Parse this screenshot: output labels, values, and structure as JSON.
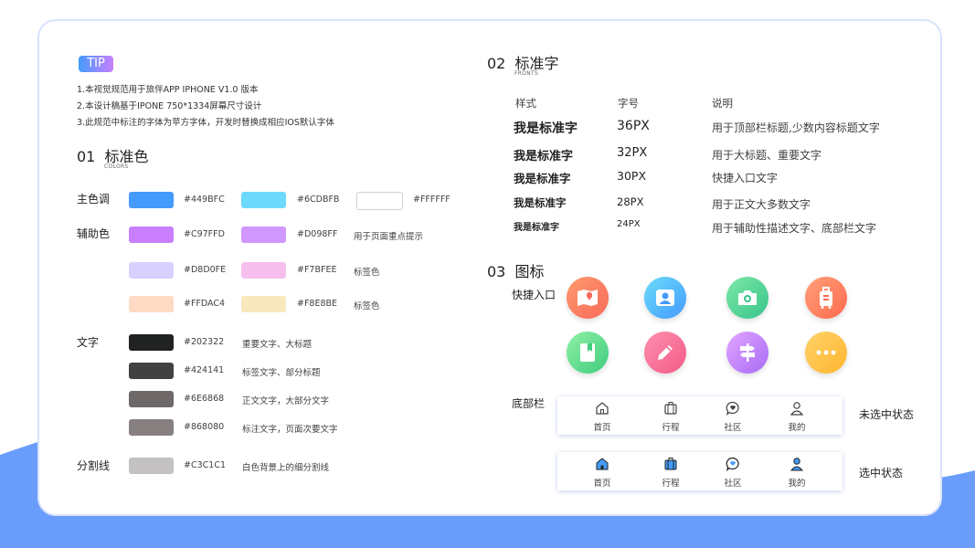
{
  "tip": {
    "badge": "TIP",
    "lines": [
      "1.本视觉规范用于旅伴APP IPHONE V1.0 版本",
      "2.本设计稿基于IPONE 750*1334屏幕尺寸设计",
      "3.此规范中标注的字体为苹方字体，开发时替换成相应IOS默认字体"
    ]
  },
  "colors_section": {
    "number": "01",
    "title": "标准色",
    "subtitle": "COLORS",
    "rows": [
      {
        "label": "主色调",
        "swatches": [
          {
            "color": "#449BFC",
            "hex": "#449BFC"
          },
          {
            "color": "#6CDBFB",
            "hex": "#6CDBFB"
          },
          {
            "color": "#FFFFFF",
            "hex": "#FFFFFF"
          }
        ],
        "note": ""
      },
      {
        "label": "辅助色",
        "swatches": [
          {
            "color": "#C97FFD",
            "hex": "#C97FFD"
          },
          {
            "color": "#D098FF",
            "hex": "#D098FF"
          }
        ],
        "note": "用于页面重点提示"
      },
      {
        "label": "",
        "swatches": [
          {
            "color": "#D8D0FE",
            "hex": "#D8D0FE"
          },
          {
            "color": "#F7BFEE",
            "hex": "#F7BFEE"
          }
        ],
        "note": "标签色"
      },
      {
        "label": "",
        "swatches": [
          {
            "color": "#FFDAC4",
            "hex": "#FFDAC4"
          },
          {
            "color": "#F8E8BE",
            "hex": "#F8E8BE"
          }
        ],
        "note": "标签色"
      }
    ],
    "text_label": "文字",
    "text_colors": [
      {
        "color": "#202322",
        "hex": "#202322",
        "note": "重要文字、大标题"
      },
      {
        "color": "#424141",
        "hex": "#424141",
        "note": "标签文字、部分标题"
      },
      {
        "color": "#6E6868",
        "hex": "#6E6868",
        "note": "正文文字，大部分文字"
      },
      {
        "color": "#868080",
        "hex": "#868080",
        "note": "标注文字，页面次要文字"
      }
    ],
    "divider_label": "分割线",
    "divider": {
      "color": "#C3C1C1",
      "hex": "#C3C1C1",
      "note": "白色背景上的细分割线"
    }
  },
  "fonts_section": {
    "number": "02",
    "title": "标准字",
    "subtitle": "FRONTS",
    "headers": {
      "style": "样式",
      "size": "字号",
      "desc": "说明"
    },
    "rows": [
      {
        "sample": "我是标准字",
        "size": "36PX",
        "desc": "用于顶部栏标题,少数内容标题文字"
      },
      {
        "sample": "我是标准字",
        "size": "32PX",
        "desc": "用于大标题、重要文字"
      },
      {
        "sample": "我是标准字",
        "size": "30PX",
        "desc": "快捷入口文字"
      },
      {
        "sample": "我是标准字",
        "size": "28PX",
        "desc": "用于正文大多数文字"
      },
      {
        "sample": "我是标准字",
        "size": "24PX",
        "desc": "用于辅助性描述文字、底部栏文字"
      }
    ]
  },
  "icons_section": {
    "number": "03",
    "title": "图标",
    "quick_label": "快捷入口",
    "quick_icons": [
      {
        "name": "map-book-icon",
        "from": "#FF9A6E",
        "to": "#F86A5A"
      },
      {
        "name": "user-card-icon",
        "from": "#6CDBFB",
        "to": "#449BFC"
      },
      {
        "name": "camera-icon",
        "from": "#7EE8A8",
        "to": "#37C48A"
      },
      {
        "name": "luggage-icon",
        "from": "#FFA07A",
        "to": "#FF6A4D"
      },
      {
        "name": "bookmark-book-icon",
        "from": "#8FF0A4",
        "to": "#3FCC7E"
      },
      {
        "name": "pencil-icon",
        "from": "#FF8FB0",
        "to": "#F25A86"
      },
      {
        "name": "signpost-icon",
        "from": "#E1A5FF",
        "to": "#A86BF6"
      },
      {
        "name": "more-dots-icon",
        "from": "#FFD36B",
        "to": "#FFB52E"
      }
    ],
    "tabbar_label": "底部栏",
    "tabs": [
      "首页",
      "行程",
      "社区",
      "我的"
    ],
    "unselected_label": "未选中状态",
    "selected_label": "选中状态"
  }
}
